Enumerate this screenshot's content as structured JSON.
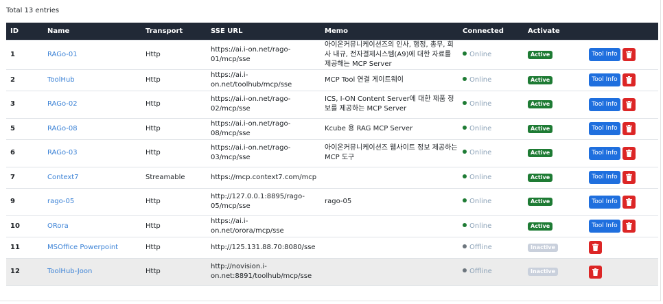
{
  "summary": {
    "total_label": "Total 13 entries"
  },
  "colors": {
    "active": "#1e7b34",
    "inactive": "#c9d0dc",
    "online_dot": "#1e7b34",
    "offline_dot": "#6c757d"
  },
  "columns": [
    {
      "key": "id",
      "label": "ID"
    },
    {
      "key": "name",
      "label": "Name"
    },
    {
      "key": "transport",
      "label": "Transport"
    },
    {
      "key": "sse_url",
      "label": "SSE URL"
    },
    {
      "key": "memo",
      "label": "Memo"
    },
    {
      "key": "connected",
      "label": "Connected"
    },
    {
      "key": "activate",
      "label": "Activate"
    },
    {
      "key": "actions",
      "label": ""
    }
  ],
  "action_labels": {
    "tool_info": "Tool Info"
  },
  "rows": [
    {
      "id": "1",
      "name": "RAGo-01",
      "transport": "Http",
      "sse_url": "https://ai.i-on.net/rago-01/mcp/sse",
      "memo": "아이온커뮤니케이션즈의 인사, 행정, 총무, 회사 내규, 전자결제시스템(A9)에 대한 자료를 제공해는 MCP Server",
      "connected": "Online",
      "activate": "Active",
      "tool_info": true
    },
    {
      "id": "2",
      "name": "ToolHub",
      "transport": "Http",
      "sse_url": "https://ai.i-on.net/toolhub/mcp/sse",
      "memo": "MCP Tool 연결 게이트웨이",
      "connected": "Online",
      "activate": "Active",
      "tool_info": true
    },
    {
      "id": "3",
      "name": "RAGo-02",
      "transport": "Http",
      "sse_url": "https://ai.i-on.net/rago-02/mcp/sse",
      "memo": "ICS, I-ON Content Server에 대한 제품 정보를 제공하는 MCP Server",
      "connected": "Online",
      "activate": "Active",
      "tool_info": true
    },
    {
      "id": "5",
      "name": "RAGo-08",
      "transport": "Http",
      "sse_url": "https://ai.i-on.net/rago-08/mcp/sse",
      "memo": "Kcube 용 RAG MCP Server",
      "connected": "Online",
      "activate": "Active",
      "tool_info": true
    },
    {
      "id": "6",
      "name": "RAGo-03",
      "transport": "Http",
      "sse_url": "https://ai.i-on.net/rago-03/mcp/sse",
      "memo": "아이온커뮤니케이션즈 웹사이트 정보 제공하는 MCP 도구",
      "connected": "Online",
      "activate": "Active",
      "tool_info": true
    },
    {
      "id": "7",
      "name": "Context7",
      "transport": "Streamable",
      "sse_url": "https://mcp.context7.com/mcp",
      "memo": "",
      "connected": "Online",
      "activate": "Active",
      "tool_info": true
    },
    {
      "id": "9",
      "name": "rago-05",
      "transport": "Http",
      "sse_url": "http://127.0.0.1:8895/rago-05/mcp/sse",
      "memo": "rago-05",
      "connected": "Online",
      "activate": "Active",
      "tool_info": true
    },
    {
      "id": "10",
      "name": "ORora",
      "transport": "Http",
      "sse_url": "https://ai.i-on.net/orora/mcp/sse",
      "memo": "",
      "connected": "Online",
      "activate": "Active",
      "tool_info": true
    },
    {
      "id": "11",
      "name": "MSOffice Powerpoint",
      "transport": "Http",
      "sse_url": "http://125.131.88.70:8080/sse",
      "memo": "",
      "connected": "Offline",
      "activate": "Inactive",
      "tool_info": false
    },
    {
      "id": "12",
      "name": "ToolHub-Joon",
      "transport": "Http",
      "sse_url": "http://novision.i-on.net:8891/toolhub/mcp/sse",
      "memo": "",
      "connected": "Offline",
      "activate": "Inactive",
      "tool_info": false
    }
  ]
}
